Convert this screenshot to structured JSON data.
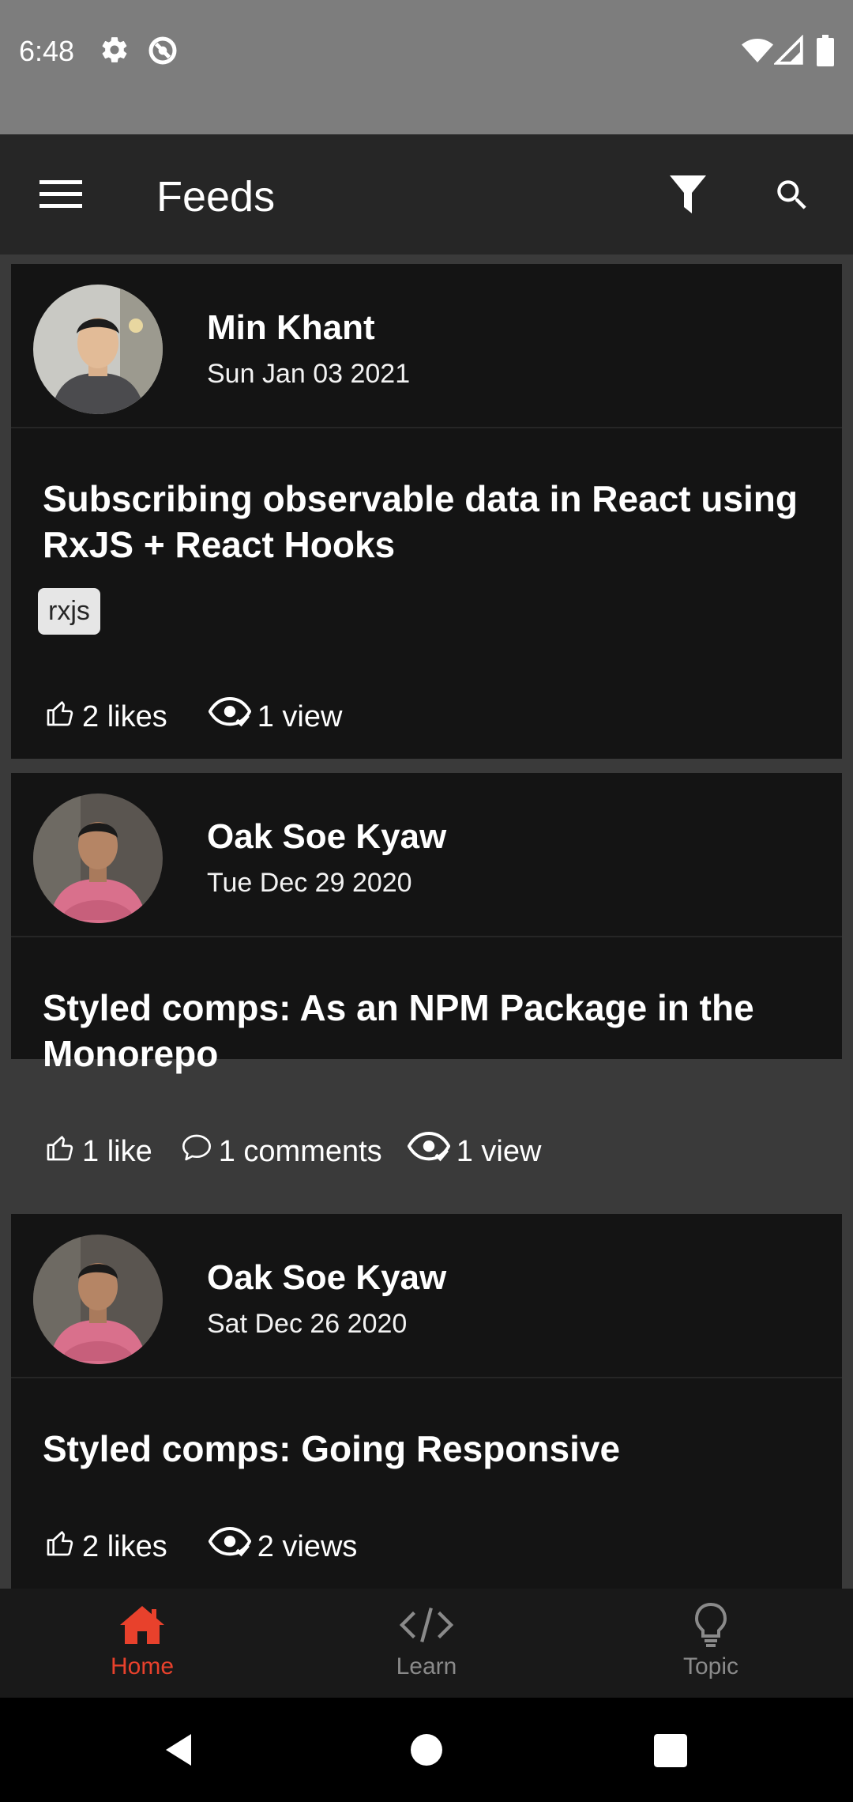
{
  "status_bar": {
    "time": "6:48",
    "left_icons": [
      "gear-icon",
      "do-not-disturb-icon"
    ],
    "right_icons": [
      "wifi-icon",
      "signal-icon",
      "battery-icon"
    ]
  },
  "app_bar": {
    "title": "Feeds",
    "icons": [
      "menu-icon",
      "filter-icon",
      "search-icon"
    ]
  },
  "posts": [
    {
      "author": "Min Khant",
      "date": "Sun Jan 03 2021",
      "title": "Subscribing observable data in React using RxJS + React Hooks",
      "tags": [
        "rxjs"
      ],
      "likes": "2 likes",
      "comments": "",
      "views": "1 view"
    },
    {
      "author": "Oak Soe Kyaw",
      "date": "Tue Dec 29 2020",
      "title": "Styled comps: As an NPM Package in the Monorepo",
      "tags": [],
      "likes": "1 like",
      "comments": "1 comments",
      "views": "1 view"
    },
    {
      "author": "Oak Soe Kyaw",
      "date": "Sat Dec 26 2020",
      "title": "Styled comps: Going Responsive",
      "tags": [],
      "likes": "2 likes",
      "comments": "",
      "views": "2 views"
    }
  ],
  "bottom_nav": {
    "items": [
      {
        "label": "Home",
        "icon": "home-icon",
        "active": true
      },
      {
        "label": "Learn",
        "icon": "code-icon",
        "active": false
      },
      {
        "label": "Topic",
        "icon": "lightbulb-icon",
        "active": false
      }
    ]
  },
  "colors": {
    "accent": "#e8412c",
    "card_bg": "#141414",
    "inactive_nav": "#8a8a8a"
  },
  "system_nav": {
    "icons": [
      "back-icon",
      "home-circle-icon",
      "recents-icon"
    ]
  }
}
